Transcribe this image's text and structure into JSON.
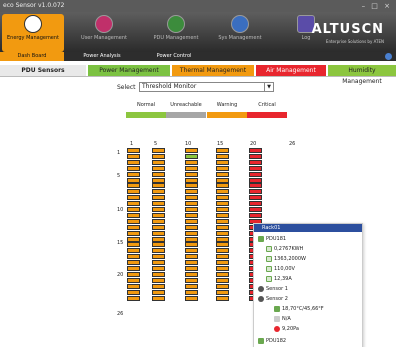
{
  "window": {
    "title": "eco Sensor v1.0.072",
    "controls": "– □ ×"
  },
  "toolbar": {
    "items": [
      {
        "label": "Energy Management",
        "active": true
      },
      {
        "label": "User Management",
        "active": false
      },
      {
        "label": "PDU Management",
        "active": false
      },
      {
        "label": "Sys Management",
        "active": false
      },
      {
        "label": "Log",
        "active": false
      }
    ],
    "brand": "ALTUSCN",
    "brand_sub": "Enterprise Solutions by ATEN"
  },
  "subnav": {
    "items": [
      {
        "label": "Dash Board",
        "selected": true
      },
      {
        "label": "Power Analysis",
        "selected": false
      },
      {
        "label": "Power Control",
        "selected": false
      }
    ]
  },
  "tabs": [
    {
      "label": "PDU Sensors",
      "color": "#e9e9e9"
    },
    {
      "label": "Power Management",
      "color": "#7cc242"
    },
    {
      "label": "Thermal Management",
      "color": "#f29a10"
    },
    {
      "label": "Air Management",
      "color": "#e8262e"
    },
    {
      "label": "Humidity Management",
      "color": "#8cc63f"
    }
  ],
  "select": {
    "label": "Select",
    "value": "Threshold Monitor"
  },
  "legend": [
    {
      "label": "Normal",
      "color": "#8cc63f"
    },
    {
      "label": "Unreachable",
      "color": "#a6a6a6"
    },
    {
      "label": "Warning",
      "color": "#f29a10"
    },
    {
      "label": "Critical",
      "color": "#e8262e"
    }
  ],
  "grid": {
    "col_labels": [
      "1",
      "5",
      "10",
      "15",
      "20",
      "26"
    ],
    "row_labels": [
      "1",
      "5",
      "10",
      "15",
      "20",
      "26"
    ]
  },
  "popup": {
    "rack": "Rack01",
    "pdu": "PDU181",
    "energy": "0,2767KWH",
    "power": "1363,2000W",
    "voltage": "110,00V",
    "current": "12,39A",
    "sensor1": "Sensor 1",
    "sensor2": "Sensor 2",
    "temp_hum": "18,70°C/45,66°F",
    "na": "N/A",
    "pa": "9,20Pa",
    "pdu2": "PDU182"
  }
}
